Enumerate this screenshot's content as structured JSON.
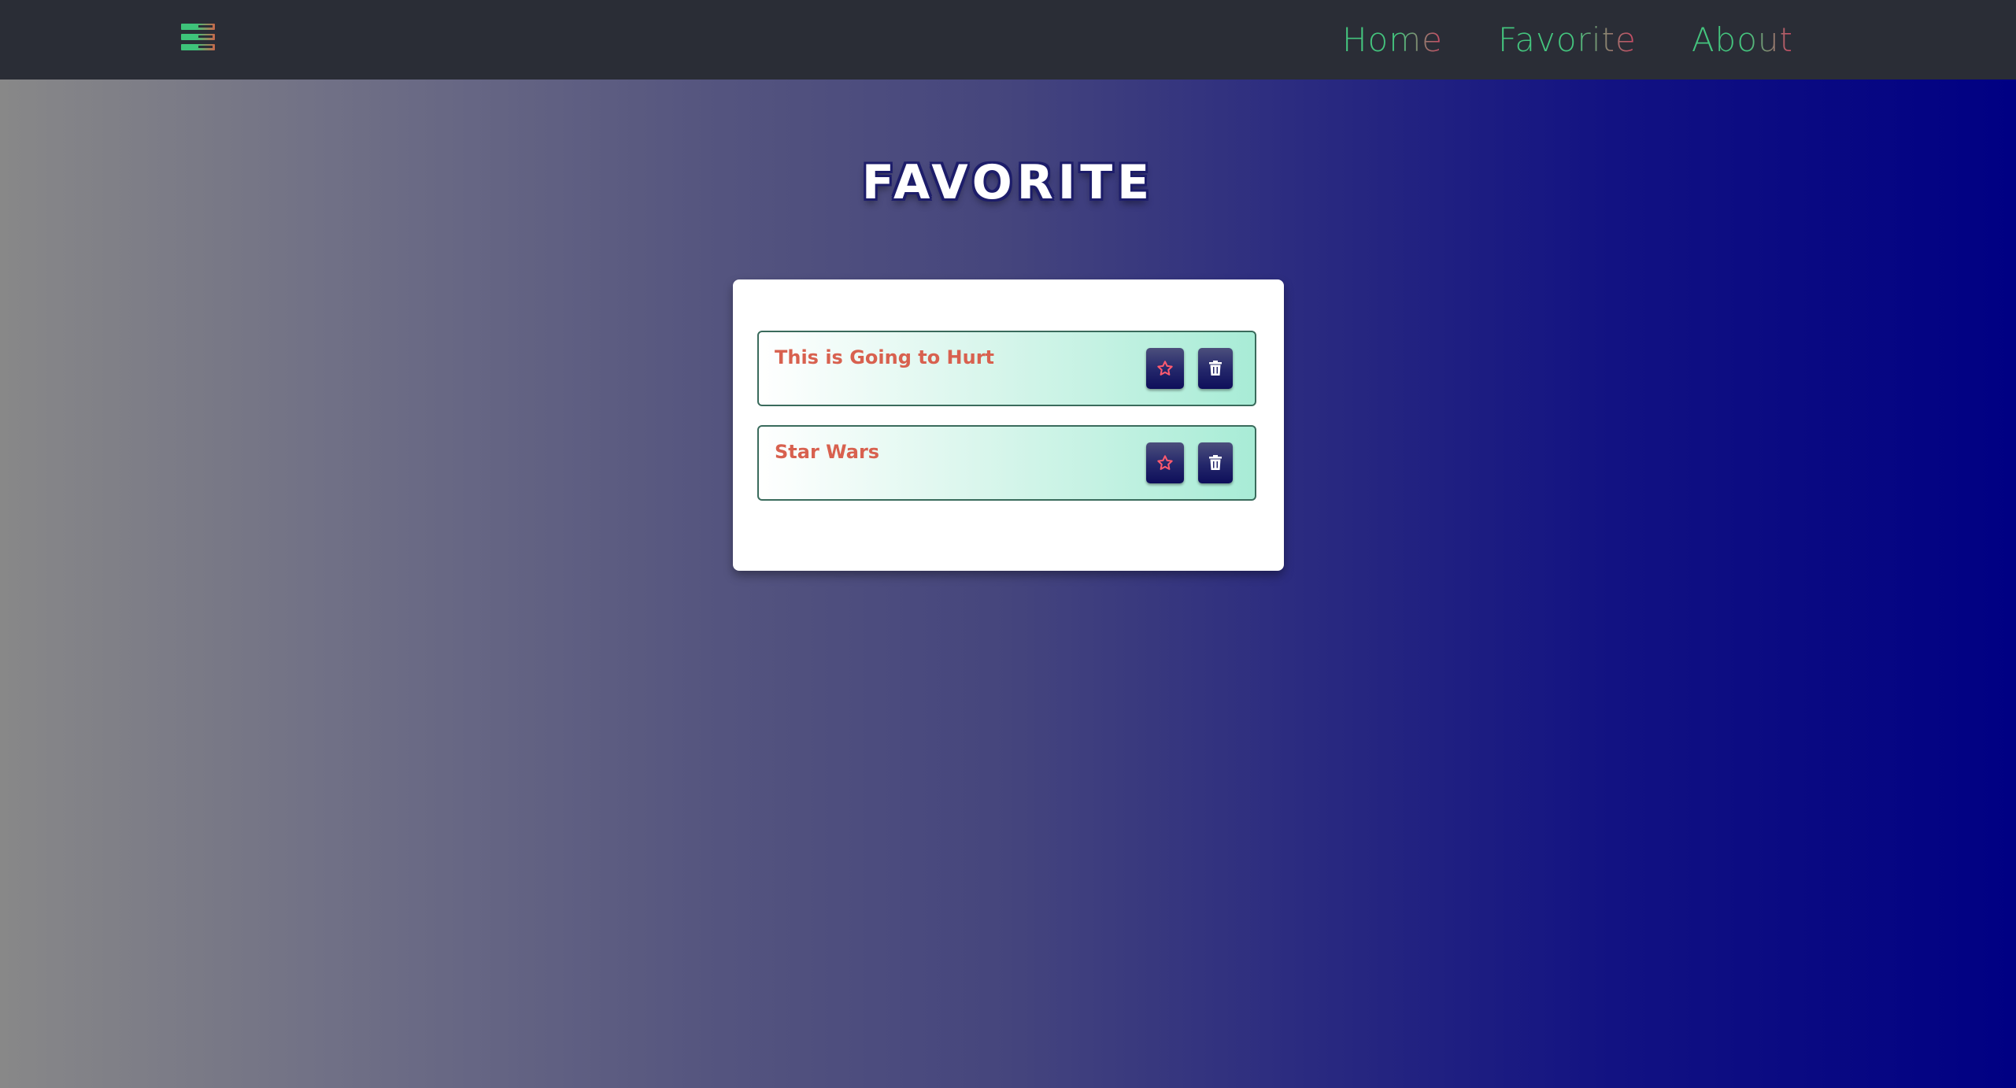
{
  "navbar": {
    "menu_icon": "hamburger-icon",
    "links": [
      {
        "label": "Home"
      },
      {
        "label": "Favorite"
      },
      {
        "label": "About"
      }
    ]
  },
  "page": {
    "title": "FAVORITE"
  },
  "favorites": [
    {
      "title": "This is Going to Hurt",
      "favorite_icon": "star-icon",
      "delete_icon": "trash-icon"
    },
    {
      "title": "Star Wars",
      "favorite_icon": "star-icon",
      "delete_icon": "trash-icon"
    }
  ],
  "colors": {
    "navbar_bg": "#2a2d36",
    "link_gradient_start": "#44c57e",
    "link_gradient_end": "#cf4563",
    "item_title": "#d8614f",
    "star_outline": "#ff5a6e",
    "button_bg": "#23266a"
  }
}
